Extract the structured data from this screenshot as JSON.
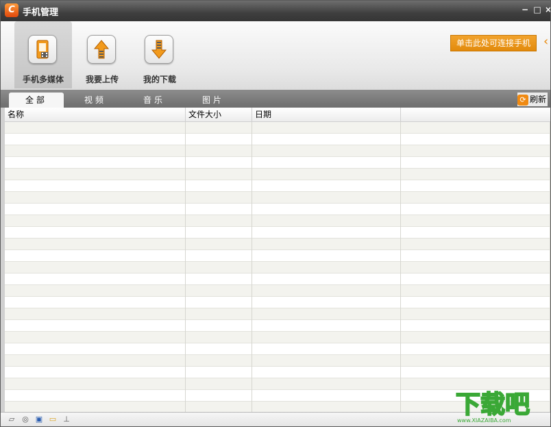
{
  "window": {
    "title": "手机管理",
    "logo_letter": "C"
  },
  "toolbar": {
    "items": [
      {
        "label": "手机多媒体",
        "icon": "multimedia-phone-icon",
        "active": true
      },
      {
        "label": "我要上传",
        "icon": "upload-arrow-icon",
        "active": false
      },
      {
        "label": "我的下载",
        "icon": "download-arrow-icon",
        "active": false
      }
    ],
    "connect_label": "单击此处可连接手机"
  },
  "tabs": [
    {
      "label": "全部",
      "active": true
    },
    {
      "label": "视频",
      "active": false
    },
    {
      "label": "音乐",
      "active": false
    },
    {
      "label": "图片",
      "active": false
    }
  ],
  "refresh_label": "刷新",
  "table": {
    "columns": [
      "名称",
      "文件大小",
      "日期",
      ""
    ],
    "row_count": 25
  },
  "statusbar": {
    "icons": [
      "disk-icon",
      "cd-icon",
      "save-icon",
      "folder-icon",
      "usb-icon"
    ]
  },
  "watermark": {
    "text": "下载吧",
    "subtext": "www.XIAZAIBA.com"
  },
  "colors": {
    "accent": "#e8890a",
    "titlebar": "#3f3f3f",
    "tabbar": "#7a7a7a"
  }
}
